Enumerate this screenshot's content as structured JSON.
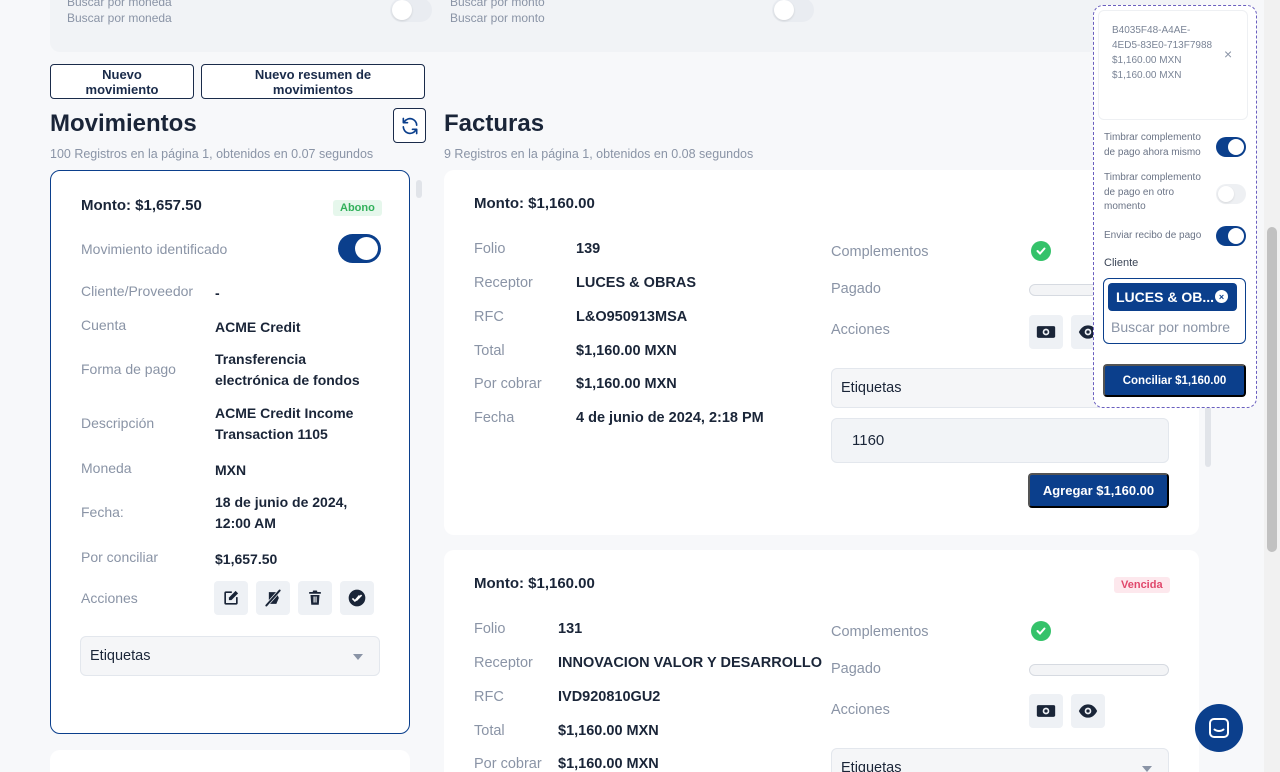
{
  "filters": {
    "moneda_label": "Buscar por moneda",
    "moneda_placeholder": "Buscar por moneda",
    "monto_label": "Buscar por monto",
    "monto_placeholder": "Buscar por monto"
  },
  "toolbar": {
    "nuevo_movimiento": "Nuevo movimiento",
    "nuevo_resumen": "Nuevo resumen de movimientos"
  },
  "movimientos": {
    "title": "Movimientos",
    "subtitle": "100 Registros en la página 1, obtenidos en 0.07 segundos",
    "card": {
      "amount": "Monto: $1,657.50",
      "badge": "Abono",
      "identificado_label": "Movimiento identificado",
      "identificado_on": true,
      "cliente_label": "Cliente/Proveedor",
      "cliente_value": "-",
      "cuenta_label": "Cuenta",
      "cuenta_value": "ACME Credit",
      "forma_label": "Forma de pago",
      "forma_value": "Transferencia electrónica de fondos",
      "descripcion_label": "Descripción",
      "descripcion_value": "ACME Credit Income Transaction 1105",
      "moneda_label": "Moneda",
      "moneda_value": "MXN",
      "fecha_label": "Fecha:",
      "fecha_value": "18 de junio de 2024, 12:00 AM",
      "por_conciliar_label": "Por conciliar",
      "por_conciliar_value": "$1,657.50",
      "acciones_label": "Acciones",
      "etiquetas": "Etiquetas"
    }
  },
  "facturas": {
    "title": "Facturas",
    "subtitle": "9 Registros en la página 1, obtenidos en 0.08 segundos",
    "labels": {
      "folio": "Folio",
      "receptor": "Receptor",
      "rfc": "RFC",
      "total": "Total",
      "por_cobrar": "Por cobrar",
      "fecha": "Fecha",
      "complementos": "Complementos",
      "pagado": "Pagado",
      "acciones": "Acciones",
      "etiquetas": "Etiquetas"
    },
    "items": [
      {
        "amount": "Monto: $1,160.00",
        "folio": "139",
        "receptor": "LUCES & OBRAS",
        "rfc": "L&O950913MSA",
        "total": "$1,160.00 MXN",
        "por_cobrar": "$1,160.00 MXN",
        "fecha": "4 de junio de 2024, 2:18 PM",
        "pagado_fraction": 0,
        "input_value": "1160",
        "agregar": "Agregar $1,160.00"
      },
      {
        "amount": "Monto: $1,160.00",
        "badge": "Vencida",
        "folio": "131",
        "receptor": "INNOVACION VALOR Y DESARROLLO",
        "rfc": "IVD920810GU2",
        "total": "$1,160.00 MXN",
        "por_cobrar": "$1,160.00 MXN",
        "pagado_fraction": 0
      }
    ]
  },
  "panel": {
    "id_line1": "B4035F48-A4AE-",
    "id_line2": "4ED5-83E0-713F7988",
    "amount1": "$1,160.00 MXN",
    "amount2": "$1,160.00 MXN",
    "close": "×",
    "timbrar_ahora": "Timbrar complemento de pago ahora mismo",
    "timbrar_ahora_on": true,
    "timbrar_otro": "Timbrar complemento de pago en otro momento",
    "timbrar_otro_on": false,
    "enviar_recibo": "Enviar recibo de pago",
    "enviar_recibo_on": true,
    "cliente_label": "Cliente",
    "cliente_chip": "LUCES & OB...",
    "cliente_chip_x": "×",
    "search_placeholder": "Buscar por nombre",
    "conciliar": "Conciliar $1,160.00"
  },
  "colors": {
    "primary": "#0b3f8c",
    "success": "#34c26a",
    "danger": "#e0476b",
    "muted": "#8a94a6"
  }
}
